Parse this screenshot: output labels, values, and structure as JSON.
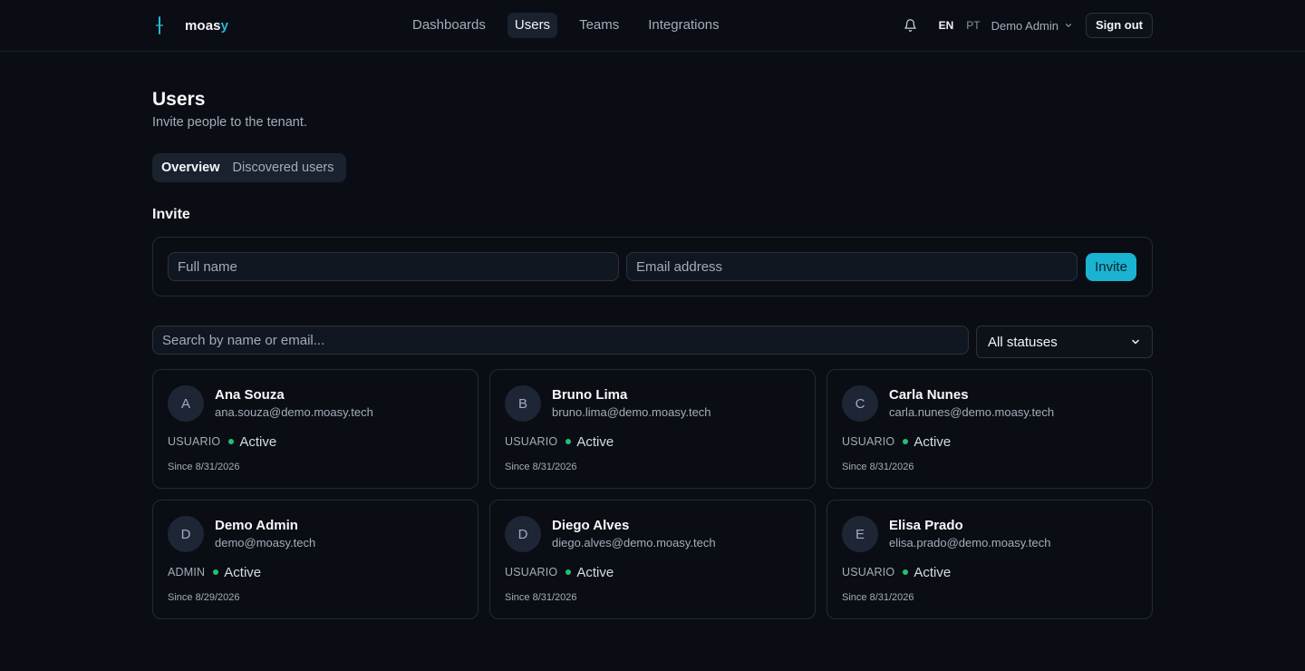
{
  "brand": {
    "name_prefix": "moas",
    "name_accent": "y",
    "accent_color": "#22b8d6"
  },
  "nav": {
    "items": [
      {
        "label": "Dashboards",
        "active": false
      },
      {
        "label": "Users",
        "active": true
      },
      {
        "label": "Teams",
        "active": false
      },
      {
        "label": "Integrations",
        "active": false
      }
    ]
  },
  "header_right": {
    "notification_icon": "bell-icon",
    "languages": [
      "EN",
      "PT"
    ],
    "active_language": "EN",
    "user_menu_label": "Demo Admin",
    "sign_out_label": "Sign out"
  },
  "page": {
    "title": "Users",
    "subtitle": "Invite people to the tenant.",
    "tabs": [
      {
        "label": "Overview",
        "active": true
      },
      {
        "label": "Discovered users",
        "active": false
      }
    ]
  },
  "invite": {
    "section_title": "Invite",
    "full_name_placeholder": "Full name",
    "email_placeholder": "Email address",
    "button_label": "Invite",
    "button_color": "#1ab4d2"
  },
  "filters": {
    "search_placeholder": "Search by name or email...",
    "status_selected": "All statuses"
  },
  "users": [
    {
      "initial": "A",
      "name": "Ana Souza",
      "email": "ana.souza@demo.moasy.tech",
      "role": "USUARIO",
      "status": "Active",
      "since": "Since 8/31/2026"
    },
    {
      "initial": "B",
      "name": "Bruno Lima",
      "email": "bruno.lima@demo.moasy.tech",
      "role": "USUARIO",
      "status": "Active",
      "since": "Since 8/31/2026"
    },
    {
      "initial": "C",
      "name": "Carla Nunes",
      "email": "carla.nunes@demo.moasy.tech",
      "role": "USUARIO",
      "status": "Active",
      "since": "Since 8/31/2026"
    },
    {
      "initial": "D",
      "name": "Demo Admin",
      "email": "demo@moasy.tech",
      "role": "ADMIN",
      "status": "Active",
      "since": "Since 8/29/2026"
    },
    {
      "initial": "D",
      "name": "Diego Alves",
      "email": "diego.alves@demo.moasy.tech",
      "role": "USUARIO",
      "status": "Active",
      "since": "Since 8/31/2026"
    },
    {
      "initial": "E",
      "name": "Elisa Prado",
      "email": "elisa.prado@demo.moasy.tech",
      "role": "USUARIO",
      "status": "Active",
      "since": "Since 8/31/2026"
    }
  ],
  "status_colors": {
    "active": "#22c07a"
  }
}
